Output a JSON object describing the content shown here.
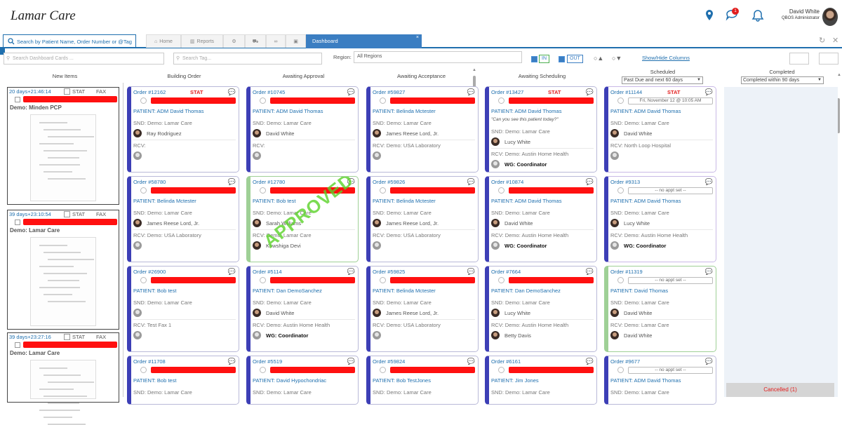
{
  "header": {
    "logo": "Lamar Care",
    "user_name": "David White",
    "user_role": "QBOS Administrator",
    "chat_badge": "1"
  },
  "tabs": {
    "search_placeholder": "Search by Patient Name, Order Number or @Tag",
    "home": "Home",
    "reports": "Reports",
    "dashboard": "Dashboard",
    "close": "×"
  },
  "filters": {
    "card_search_placeholder": "Search Dashboard Cards ...",
    "tag_placeholder": "Search Tag...",
    "region_label": "Region:",
    "region_value": "All Regions",
    "in_label": "IN",
    "out_label": "OUT",
    "show_hide": "Show/Hide Columns"
  },
  "columns": {
    "new": "New Items",
    "building": "Building Order",
    "awaiting_approval": "Awaiting Approval",
    "awaiting_acceptance": "Awaiting Acceptance",
    "awaiting_scheduling": "Awaiting Scheduling",
    "scheduled": "Scheduled",
    "scheduled_filter": "Past Due and next 60 days",
    "completed": "Completed",
    "completed_filter": "Completed within 90 days",
    "cancelled": "Cancelled (1)"
  },
  "new_items": [
    {
      "days": "20 days+21:46:14",
      "stat": "STAT",
      "fax": "FAX",
      "source": "Demo: Minden PCP"
    },
    {
      "days": "39 days+23:10:54",
      "stat": "STAT",
      "fax": "FAX",
      "source": "Demo: Lamar Care"
    },
    {
      "days": "39 days+23:27:16",
      "stat": "STAT",
      "fax": "FAX",
      "source": "Demo: Lamar Care"
    }
  ],
  "labels": {
    "stat": "STAT",
    "approved": "APPROVED",
    "coordinator": "WG: Coordinator",
    "no_appt": "-- no appt set --"
  },
  "building": [
    {
      "order": "Order #12162",
      "stat": true,
      "patient": "PATIENT: ADM David Thomas",
      "snd": "SND: Demo: Lamar Care",
      "snd_person": "Ray Rodriguez",
      "rcv": "RCV:"
    },
    {
      "order": "Order #58780",
      "patient": "PATIENT: Belinda Mctester",
      "snd": "SND: Demo: Lamar Care",
      "snd_person": "James Reese Lord, Jr.",
      "rcv": "RCV: Demo: USA Laboratory"
    },
    {
      "order": "Order #26900",
      "patient": "PATIENT: Bob test",
      "snd": "SND: Demo: Lamar Care",
      "rcv": "RCV: Test Fax 1"
    },
    {
      "order": "Order #11708",
      "patient": "PATIENT: Bob test",
      "snd": "SND: Demo: Lamar Care"
    }
  ],
  "approval": [
    {
      "order": "Order #10745",
      "patient": "PATIENT: ADM David Thomas",
      "snd": "SND: Demo: Lamar Care",
      "snd_person": "David White",
      "rcv": "RCV:"
    },
    {
      "order": "Order #12780",
      "patient": "PATIENT: Bob test",
      "snd": "SND: Demo: Lamar Care",
      "snd_person": "Sarah Williams",
      "rcv": "RCV: Demo: Lamar Care",
      "rcv_person": "Kowshiga Devi"
    },
    {
      "order": "Order #5114",
      "patient": "PATIENT: Dan DemoSanchez",
      "snd": "SND: Demo: Lamar Care",
      "snd_person": "David White",
      "rcv": "RCV: Demo: Austin Home Health"
    },
    {
      "order": "Order #5519",
      "patient": "PATIENT: David Hypochondriac",
      "snd": "SND: Demo: Lamar Care"
    }
  ],
  "acceptance": [
    {
      "order": "Order #59827",
      "patient": "PATIENT: Belinda Mctester",
      "snd": "SND: Demo: Lamar Care",
      "snd_person": "James Reese Lord, Jr.",
      "rcv": "RCV: Demo: USA Laboratory"
    },
    {
      "order": "Order #59826",
      "patient": "PATIENT: Belinda Mctester",
      "snd": "SND: Demo: Lamar Care",
      "snd_person": "James Reese Lord, Jr.",
      "rcv": "RCV: Demo: USA Laboratory"
    },
    {
      "order": "Order #59825",
      "patient": "PATIENT: Belinda Mctester",
      "snd": "SND: Demo: Lamar Care",
      "snd_person": "James Reese Lord, Jr.",
      "rcv": "RCV: Demo: USA Laboratory"
    },
    {
      "order": "Order #59824",
      "patient": "PATIENT: Bob TestJones",
      "snd": "SND: Demo: Lamar Care"
    }
  ],
  "scheduling": [
    {
      "order": "Order #13427",
      "stat": true,
      "patient": "PATIENT: ADM David Thomas",
      "quote": "\"Can you see this patient today?\"",
      "snd": "SND: Demo: Lamar Care",
      "snd_person": "Lucy White",
      "rcv": "RCV: Demo: Austin Home Health"
    },
    {
      "order": "Order #10874",
      "patient": "PATIENT: ADM David Thomas",
      "snd": "SND: Demo: Lamar Care",
      "snd_person": "David White",
      "rcv": "RCV: Demo: Austin Home Health"
    },
    {
      "order": "Order #7664",
      "patient": "PATIENT: Dan DemoSanchez",
      "snd": "SND: Demo: Lamar Care",
      "snd_person": "Lucy White",
      "rcv": "RCV: Demo: Austin Home Health",
      "rcv_person": "Betty Davis"
    },
    {
      "order": "Order #6161",
      "patient": "PATIENT: Jim Jones",
      "snd": "SND: Demo: Lamar Care"
    }
  ],
  "scheduled": [
    {
      "order": "Order #11144",
      "stat": true,
      "appt": "Fri, November 12 @ 10:05 AM",
      "patient": "PATIENT: ADM David Thomas",
      "snd": "SND: Demo: Lamar Care",
      "snd_person": "David White",
      "rcv": "RCV: North Loop Hospital"
    },
    {
      "order": "Order #9313",
      "patient": "PATIENT: ADM David Thomas",
      "snd": "SND: Demo: Lamar Care",
      "snd_person": "Lucy White",
      "rcv": "RCV: Demo: Austin Home Health"
    },
    {
      "order": "Order #11319",
      "patient": "PATIENT: David Thomas",
      "snd": "SND: Demo: Lamar Care",
      "snd_person": "David White",
      "rcv": "RCV: Demo: Lamar Care",
      "rcv_person": "David White"
    },
    {
      "order": "Order #9677",
      "patient": "PATIENT: ADM David Thomas",
      "snd": "SND: Demo: Lamar Care"
    }
  ]
}
